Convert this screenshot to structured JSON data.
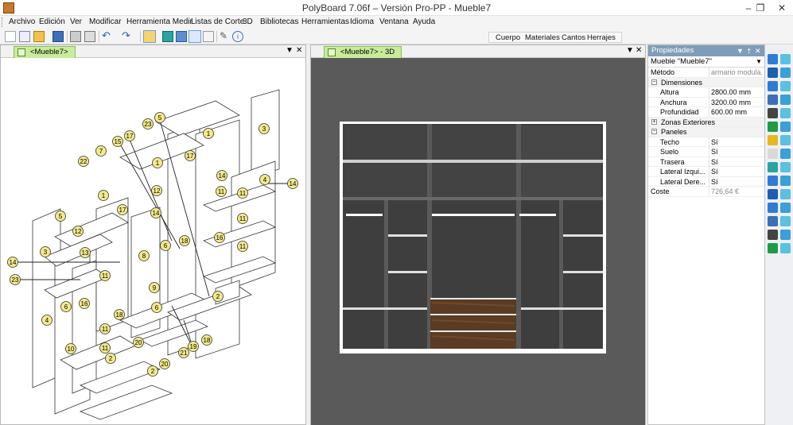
{
  "window": {
    "title": "PolyBoard 7.06f – Versión Pro-PP - Mueble7",
    "minimize": "–",
    "restore": "❐",
    "close": "✕"
  },
  "menu": {
    "items": [
      "Archivo",
      "Edición",
      "Ver",
      "Modificar",
      "Herramienta Medir",
      "Listas de Corte",
      "3D",
      "Bibliotecas",
      "Herramientas",
      "Idioma",
      "Ventana",
      "Ayuda"
    ]
  },
  "toolbar2": {
    "items": [
      "Cuerpo",
      "Materiales",
      "Cantos",
      "Herrajes"
    ]
  },
  "left_pane": {
    "tab": "<Mueble7>",
    "dropdown": "▼",
    "close": "✕",
    "part_labels": [
      "1",
      "2",
      "3",
      "4",
      "5",
      "6",
      "7",
      "8",
      "9",
      "10",
      "11",
      "12",
      "13",
      "14",
      "15",
      "16",
      "17",
      "18",
      "19",
      "20",
      "21",
      "22",
      "23"
    ],
    "label_fill": "#f2e98a"
  },
  "mid_pane": {
    "tab": "<Mueble7> - 3D",
    "dropdown": "▼",
    "close": "✕",
    "background": "#5a5a5a"
  },
  "properties": {
    "header": "Propiedades",
    "pin": "▼  †",
    "close": "✕",
    "object": "Mueble \"Mueble7\"",
    "rows": [
      {
        "type": "prop",
        "key": "Método",
        "value": "armario modula..."
      },
      {
        "type": "cat",
        "key": "Dimensiones",
        "sign": "−"
      },
      {
        "type": "prop",
        "key": "Altura",
        "value": "2800.00 mm"
      },
      {
        "type": "prop",
        "key": "Anchura",
        "value": "3200.00 mm"
      },
      {
        "type": "prop",
        "key": "Profundidad",
        "value": "600.00 mm"
      },
      {
        "type": "cat",
        "key": "Zonas Exteriores",
        "sign": "+"
      },
      {
        "type": "cat",
        "key": "Paneles",
        "sign": "−"
      },
      {
        "type": "prop",
        "key": "Techo",
        "value": "Sí"
      },
      {
        "type": "prop",
        "key": "Suelo",
        "value": "Sí"
      },
      {
        "type": "prop",
        "key": "Trasera",
        "value": "Sí"
      },
      {
        "type": "prop",
        "key": "Lateral Izqui...",
        "value": "Sí"
      },
      {
        "type": "prop",
        "key": "Lateral Dere...",
        "value": "Sí"
      },
      {
        "type": "prop",
        "key": "Coste",
        "value": "726,64 €"
      }
    ]
  },
  "toolstrip_icons": [
    "view-3d-icon",
    "rotate-icon",
    "auto-icon",
    "box-icon",
    "panel-icon",
    "light-icon",
    "material-icon"
  ],
  "colors": {
    "panel_header": "#7f9db9",
    "tab_green": "#c8ec9a",
    "drawer_wood": "#5b3b24"
  }
}
